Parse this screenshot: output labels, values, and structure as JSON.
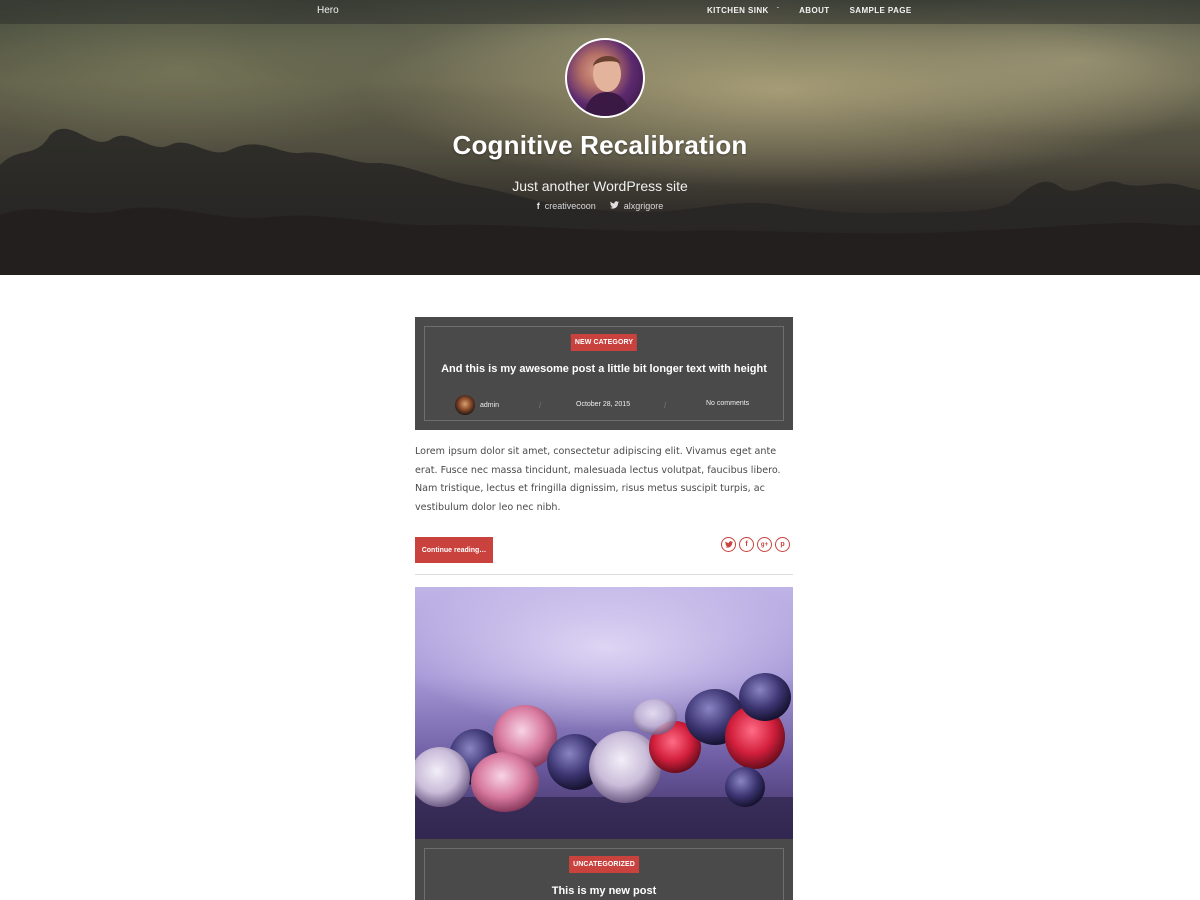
{
  "topbar": {
    "brand": "Hero",
    "nav": [
      {
        "label": "KITCHEN SINK",
        "has_dropdown": true
      },
      {
        "label": "ABOUT",
        "has_dropdown": false
      },
      {
        "label": "SAMPLE PAGE",
        "has_dropdown": false
      }
    ],
    "dropdown_glyph": "ˇ"
  },
  "hero": {
    "title": "Cognitive Recalibration",
    "tagline": "Just another WordPress site",
    "social": [
      {
        "icon": "facebook-icon",
        "glyph": "f",
        "label": "creativecoon"
      },
      {
        "icon": "twitter-icon",
        "glyph": "❧",
        "label": "alxgrigore"
      }
    ]
  },
  "posts": [
    {
      "category": "NEW CATEGORY",
      "title": "And this is my awesome post a little bit longer text with height",
      "author": "admin",
      "date": "October 28, 2015",
      "comments": "No comments",
      "separator": "/",
      "excerpt": "Lorem ipsum dolor sit amet, consectetur adipiscing elit. Vivamus eget ante erat. Fusce nec massa tincidunt, malesuada lectus volutpat, faucibus libero. Nam tristique, lectus et fringilla dignissim, risus metus suscipit turpis, ac vestibulum dolor leo nec nibh.",
      "continue_label": "Continue reading…",
      "share": [
        {
          "icon": "twitter-icon",
          "glyph": "t"
        },
        {
          "icon": "facebook-icon",
          "glyph": "f"
        },
        {
          "icon": "google-plus-icon",
          "glyph": "g+"
        },
        {
          "icon": "pinterest-icon",
          "glyph": "p"
        }
      ]
    },
    {
      "category": "UNCATEGORIZED",
      "title": "This is my new post"
    }
  ],
  "colors": {
    "accent": "#c9423e",
    "post_header_bg": "#4a4a4a",
    "text": "#4a4a4a"
  }
}
